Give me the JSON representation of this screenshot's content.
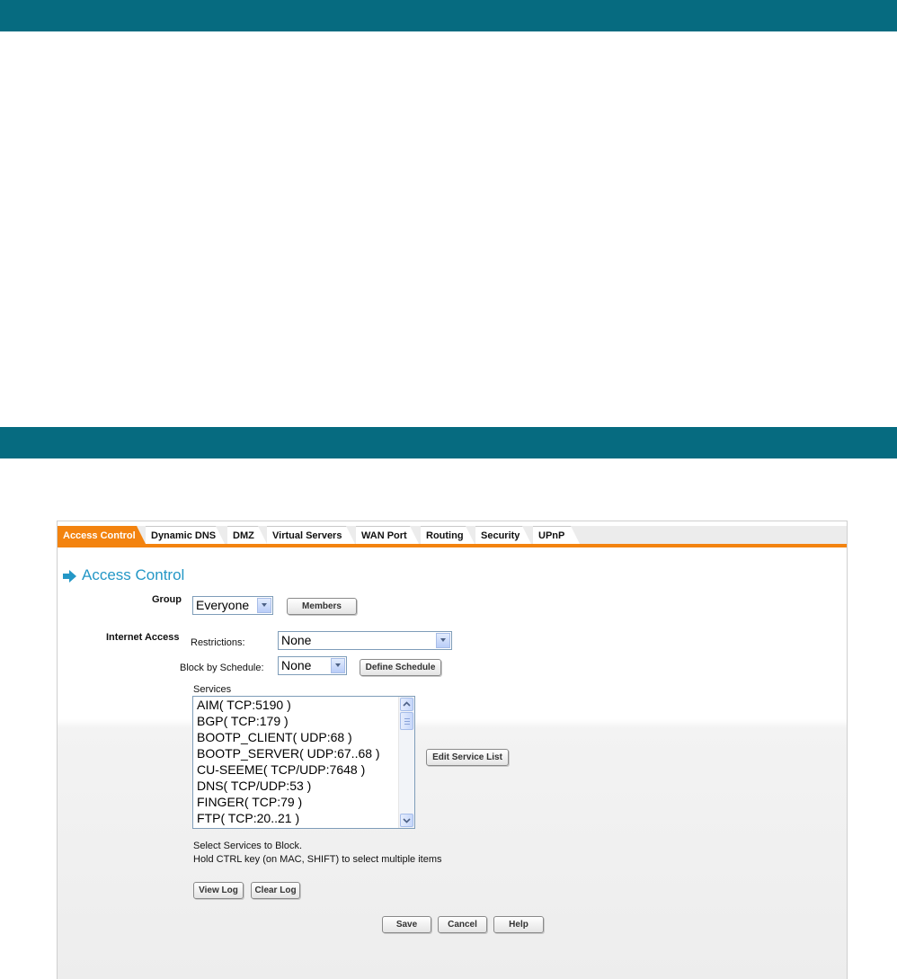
{
  "tabs": [
    {
      "label": "Access Control",
      "active": true
    },
    {
      "label": "Dynamic DNS",
      "active": false
    },
    {
      "label": "DMZ",
      "active": false
    },
    {
      "label": "Virtual Servers",
      "active": false
    },
    {
      "label": "WAN Port",
      "active": false
    },
    {
      "label": "Routing",
      "active": false
    },
    {
      "label": "Security",
      "active": false
    },
    {
      "label": "UPnP",
      "active": false
    }
  ],
  "heading": "Access Control",
  "group": {
    "label": "Group",
    "selected": "Everyone",
    "members_button": "Members"
  },
  "internet_access": {
    "label": "Internet Access",
    "restrictions_label": "Restrictions:",
    "restrictions_selected": "None",
    "schedule_label": "Block by Schedule:",
    "schedule_selected": "None",
    "define_schedule_button": "Define Schedule",
    "services_label": "Services",
    "services": [
      "AIM( TCP:5190 )",
      "BGP( TCP:179 )",
      "BOOTP_CLIENT( UDP:68 )",
      "BOOTP_SERVER( UDP:67..68 )",
      "CU-SEEME( TCP/UDP:7648 )",
      "DNS( TCP/UDP:53 )",
      "FINGER( TCP:79 )",
      "FTP( TCP:20..21 )"
    ],
    "edit_service_list_button": "Edit Service List",
    "hint_line1": "Select Services to Block.",
    "hint_line2": "Hold CTRL key (on MAC, SHIFT) to select multiple items"
  },
  "log_buttons": {
    "view_log": "View Log",
    "clear_log": "Clear Log"
  },
  "actions": {
    "save": "Save",
    "cancel": "Cancel",
    "help": "Help"
  },
  "colors": {
    "banner": "#066b80",
    "tab_accent": "#f3830f",
    "heading": "#2497c6"
  },
  "icons": {
    "heading_arrow": "arrow-right-icon",
    "scroll_up": "scroll-up-icon",
    "scroll_down": "scroll-down-icon",
    "dropdown": "chevron-down-icon"
  }
}
